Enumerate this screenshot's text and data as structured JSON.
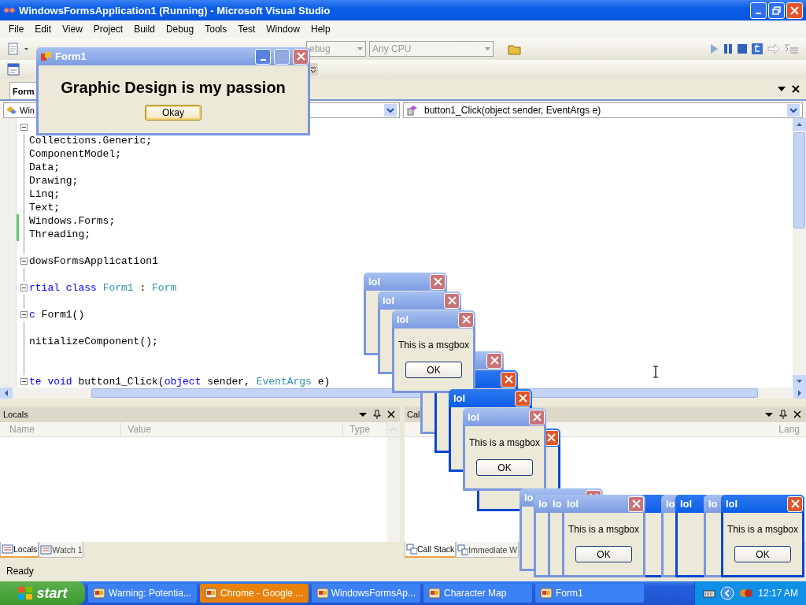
{
  "window": {
    "title": "WindowsFormsApplication1 (Running) - Microsoft Visual Studio"
  },
  "menu": [
    "File",
    "Edit",
    "View",
    "Project",
    "Build",
    "Debug",
    "Tools",
    "Test",
    "Window",
    "Help"
  ],
  "toolbar": {
    "configuration": "ebug",
    "platform": "Any CPU"
  },
  "document_tab": {
    "label": "Form",
    "selected": true
  },
  "navigation": {
    "type_combo": "Win",
    "member_combo": "button1_Click(object sender, EventArgs e)"
  },
  "code_lines": [
    {
      "fold": true,
      "changed": false
    },
    {
      "fold": false,
      "changed": false,
      "segments": [
        {
          "kind": "plain",
          "text": "Collections.Generic;"
        }
      ]
    },
    {
      "fold": false,
      "changed": false,
      "segments": [
        {
          "kind": "plain",
          "text": "ComponentModel;"
        }
      ]
    },
    {
      "fold": false,
      "changed": false,
      "segments": [
        {
          "kind": "plain",
          "text": "Data;"
        }
      ]
    },
    {
      "fold": false,
      "changed": false,
      "segments": [
        {
          "kind": "plain",
          "text": "Drawing;"
        }
      ]
    },
    {
      "fold": false,
      "changed": false,
      "segments": [
        {
          "kind": "plain",
          "text": "Linq;"
        }
      ]
    },
    {
      "fold": false,
      "changed": false,
      "segments": [
        {
          "kind": "plain",
          "text": "Text;"
        }
      ]
    },
    {
      "fold": false,
      "changed": true,
      "segments": [
        {
          "kind": "plain",
          "text": "Windows.Forms;"
        }
      ]
    },
    {
      "fold": false,
      "changed": true,
      "segments": [
        {
          "kind": "plain",
          "text": "Threading;"
        }
      ]
    },
    {
      "fold": false,
      "changed": false
    },
    {
      "fold": true,
      "changed": false,
      "segments": [
        {
          "kind": "plain",
          "text": "dowsFormsApplication1"
        }
      ]
    },
    {
      "fold": false,
      "changed": false
    },
    {
      "fold": true,
      "changed": false,
      "segments": [
        {
          "kind": "keyword",
          "text": "rtial class "
        },
        {
          "kind": "type",
          "text": "Form1"
        },
        {
          "kind": "plain",
          "text": " : "
        },
        {
          "kind": "type",
          "text": "Form"
        }
      ]
    },
    {
      "fold": false,
      "changed": false
    },
    {
      "fold": true,
      "changed": false,
      "segments": [
        {
          "kind": "keyword",
          "text": "c"
        },
        {
          "kind": "plain",
          "text": " Form1()"
        }
      ]
    },
    {
      "fold": false,
      "changed": false
    },
    {
      "fold": false,
      "changed": false,
      "segments": [
        {
          "kind": "plain",
          "text": "nitializeComponent();"
        }
      ]
    },
    {
      "fold": false,
      "changed": false
    },
    {
      "fold": false,
      "changed": false
    },
    {
      "fold": true,
      "changed": false,
      "segments": [
        {
          "kind": "keyword",
          "text": "te void"
        },
        {
          "kind": "plain",
          "text": " button1_Click("
        },
        {
          "kind": "keyword",
          "text": "object"
        },
        {
          "kind": "plain",
          "text": " sender, "
        },
        {
          "kind": "type",
          "text": "EventArgs"
        },
        {
          "kind": "plain",
          "text": " e)"
        }
      ]
    }
  ],
  "locals_panel": {
    "title": "Locals",
    "columns": [
      "Name",
      "Value",
      "Type"
    ],
    "tabs": [
      {
        "label": "Locals",
        "selected": true
      },
      {
        "label": "Watch 1",
        "selected": false
      }
    ]
  },
  "call_stack_panel": {
    "title": "Cal",
    "columns": [
      "Lang"
    ],
    "tabs": [
      {
        "label": "Call Stack",
        "selected": true
      },
      {
        "label": "Immediate W",
        "selected": false
      }
    ]
  },
  "status_bar": "Ready",
  "form_window": {
    "title": "Form1",
    "heading": "Graphic Design is my passion",
    "button": "Okay"
  },
  "message_boxes": [
    {
      "active": true
    },
    {
      "active": false
    },
    {
      "active": true
    },
    {
      "title": "lol",
      "active": false
    },
    {
      "title": "lol",
      "active": false
    },
    {
      "title": "lol",
      "active": false,
      "message": "This is a msgbox",
      "button": "OK"
    },
    {
      "title": "lol",
      "active": true
    },
    {
      "title": "lol",
      "active": false,
      "message": "This is a msgbox",
      "button": "OK"
    },
    {
      "active": true
    },
    {
      "title": "lo",
      "active": false
    },
    {
      "title": "lo",
      "active": false
    },
    {
      "title": "lo",
      "active": false
    },
    {
      "title": "lol",
      "active": false,
      "message": "This is a msgbox",
      "button": "OK"
    },
    {
      "title": "lo",
      "active": false
    },
    {
      "title": "lol",
      "active": true
    },
    {
      "title": "lo",
      "active": false
    },
    {
      "title": "lol",
      "active": true,
      "message": "This is a msgbox",
      "button": "OK"
    }
  ],
  "taskbar": {
    "start": "start",
    "tasks": [
      {
        "label": "Warning: Potentia...",
        "flashing": false
      },
      {
        "label": "Chrome - Google ...",
        "flashing": true
      },
      {
        "label": "WindowsFormsAp...",
        "flashing": false
      },
      {
        "label": "Character Map",
        "flashing": false
      },
      {
        "label": "Form1",
        "flashing": false
      }
    ],
    "clock": "12:17 AM"
  }
}
